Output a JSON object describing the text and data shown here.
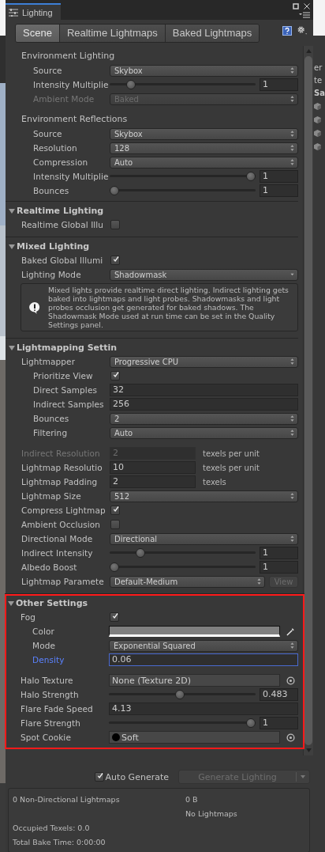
{
  "window": {
    "title": "Lighting"
  },
  "tabs": [
    {
      "label": "Scene",
      "selected": true
    },
    {
      "label": "Realtime Lightmaps",
      "selected": false
    },
    {
      "label": "Baked Lightmaps",
      "selected": false
    }
  ],
  "sections": [
    {
      "kind": "group",
      "title": "Environment Lighting",
      "groups": [
        {
          "rows": [
            {
              "kind": "dropdown",
              "label": "Source",
              "value": "Skybox",
              "disabled": false
            },
            {
              "kind": "slider",
              "label": "Intensity Multiplie",
              "level": 0.12,
              "reading": "1"
            },
            {
              "kind": "dropdown",
              "label": "Ambient Mode",
              "value": "Baked",
              "disabled": true
            }
          ]
        }
      ]
    },
    {
      "kind": "group",
      "title": "Environment Reflections",
      "groups": [
        {
          "rows": [
            {
              "kind": "dropdown",
              "label": "Source",
              "value": "Skybox",
              "disabled": false
            },
            {
              "kind": "dropdown",
              "label": "Resolution",
              "value": "128",
              "disabled": false
            },
            {
              "kind": "dropdown",
              "label": "Compression",
              "value": "Auto",
              "disabled": false
            },
            {
              "kind": "slider",
              "label": "Intensity Multiplie",
              "level": 1,
              "reading": "1"
            },
            {
              "kind": "slider",
              "label": "Bounces",
              "level": 0,
              "reading": "1"
            }
          ]
        }
      ]
    },
    {
      "kind": "foldout",
      "title": "Realtime Lighting",
      "expanded": true,
      "highlighted": false,
      "groups": [
        {
          "rows": [
            {
              "kind": "checkbox",
              "label": "Realtime Global Illu",
              "checked": false
            }
          ]
        }
      ]
    },
    {
      "kind": "foldout",
      "title": "Mixed Lighting",
      "expanded": true,
      "highlighted": false,
      "groups": [
        {
          "rows": [
            {
              "kind": "checkbox",
              "label": "Baked Global Illumi",
              "checked": true
            },
            {
              "kind": "popup",
              "label": "Lighting Mode",
              "value": "Shadowmask",
              "disabled": false
            },
            {
              "kind": "help",
              "text": "Mixed lights provide realtime direct lighting. Indirect lighting gets baked into lightmaps and light probes. Shadowmasks and light probes occlusion get generated for baked shadows. The Shadowmask Mode used at run time can be set in the Quality Settings panel."
            }
          ]
        }
      ]
    },
    {
      "kind": "foldout",
      "title": "Lightmapping Settin",
      "expanded": true,
      "highlighted": false,
      "groups": [
        {
          "rows": [
            {
              "kind": "dropdown",
              "label": "Lightmapper",
              "value": "Progressive CPU",
              "disabled": false,
              "children": [
                {
                  "kind": "checkbox",
                  "label": "Prioritize View",
                  "checked": true
                },
                {
                  "kind": "field",
                  "label": "Direct Samples",
                  "value": "32",
                  "disabled": false,
                  "focused": false
                },
                {
                  "kind": "field",
                  "label": "Indirect Samples",
                  "value": "256",
                  "disabled": false,
                  "focused": false
                },
                {
                  "kind": "dropdown",
                  "label": "Bounces",
                  "value": "2",
                  "disabled": false
                },
                {
                  "kind": "dropdown",
                  "label": "Filtering",
                  "value": "Auto",
                  "disabled": false
                }
              ]
            }
          ]
        },
        {
          "rows": [
            {
              "kind": "field",
              "label": "Indirect Resolution",
              "value": "2",
              "unit": "texels per unit",
              "disabled": true,
              "focused": false
            },
            {
              "kind": "field",
              "label": "Lightmap Resolutio",
              "value": "10",
              "unit": "texels per unit",
              "disabled": false,
              "focused": false
            },
            {
              "kind": "field",
              "label": "Lightmap Padding",
              "value": "2",
              "unit": "texels",
              "disabled": false,
              "focused": false
            },
            {
              "kind": "dropdown",
              "label": "Lightmap Size",
              "value": "512",
              "disabled": false
            },
            {
              "kind": "checkbox",
              "label": "Compress Lightmap",
              "checked": true
            },
            {
              "kind": "checkbox",
              "label": "Ambient Occlusion",
              "checked": false
            },
            {
              "kind": "dropdown",
              "label": "Directional Mode",
              "value": "Directional",
              "disabled": false
            },
            {
              "kind": "slider",
              "label": "Indirect Intensity",
              "level": 0.19,
              "reading": "1"
            },
            {
              "kind": "slider",
              "label": "Albedo Boost",
              "level": 0,
              "reading": "1"
            },
            {
              "kind": "dropdown",
              "label": "Lightmap Paramete",
              "value": "Default-Medium",
              "disabled": false,
              "button": "View"
            }
          ]
        }
      ]
    },
    {
      "kind": "foldout",
      "title": "Other Settings",
      "expanded": true,
      "highlighted": true,
      "groups": [
        {
          "rows": [
            {
              "kind": "checkbox",
              "label": "Fog",
              "checked": true,
              "children": [
                {
                  "kind": "color",
                  "label": "Color",
                  "color": "#808080"
                },
                {
                  "kind": "dropdown",
                  "label": "Mode",
                  "value": "Exponential Squared",
                  "disabled": false
                },
                {
                  "kind": "field",
                  "label": "Density",
                  "value": "0.06",
                  "disabled": false,
                  "focused": true
                }
              ]
            }
          ]
        },
        {
          "rows": [
            {
              "kind": "object",
              "label": "Halo Texture",
              "value": "None (Texture 2D)"
            },
            {
              "kind": "slider",
              "label": "Halo Strength",
              "level": 0.483,
              "reading": "0.483"
            },
            {
              "kind": "field",
              "label": "Flare Fade Speed",
              "value": "4.13",
              "disabled": false,
              "focused": false
            },
            {
              "kind": "slider",
              "label": "Flare Strength",
              "level": 1,
              "reading": "1"
            },
            {
              "kind": "preview",
              "label": "Spot Cookie",
              "value": "Soft"
            }
          ]
        }
      ]
    }
  ],
  "footer": {
    "auto_generate": {
      "label": "Auto Generate",
      "checked": true
    },
    "generate_button": {
      "label": "Generate Lighting",
      "disabled": true
    },
    "stats": [
      {
        "left": "0 Non-Directional Lightmaps",
        "right": "0 B"
      },
      {
        "right": "No Lightmaps"
      },
      {
        "left": "Occupied Texels: 0.0"
      },
      {
        "left": "Total Bake Time: 0:00:00"
      }
    ]
  },
  "side_panel": {
    "fragments": [
      "er",
      "te",
      "Sa"
    ]
  }
}
